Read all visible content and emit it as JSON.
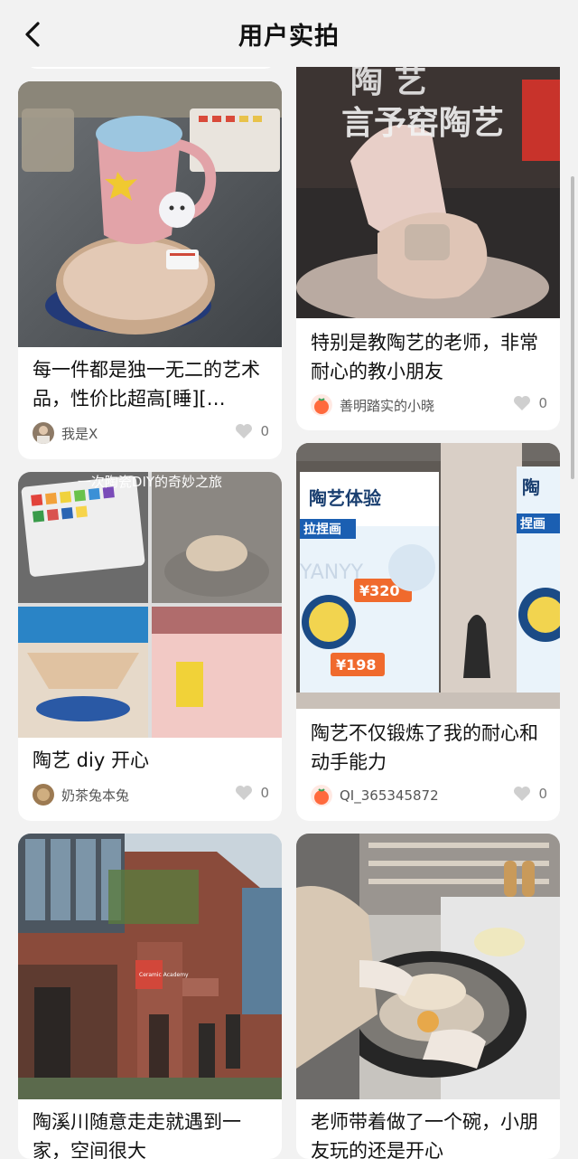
{
  "header": {
    "title": "用户实拍"
  },
  "cards": [
    {
      "caption": "每一件都是独一无二的艺术品，性价比超高[睡][…",
      "author": "我是X",
      "likes": "0"
    },
    {
      "overlay": "言予窑陶艺",
      "caption": "特别是教陶艺的老师，非常耐心的教小朋友",
      "author": "善明踏实的小晓",
      "likes": "0"
    },
    {
      "overlay": "一次陶瓷DIY的奇妙之旅",
      "caption": "陶艺 diy 开心",
      "author": "奶茶兔本兔",
      "likes": "0"
    },
    {
      "poster_title": "陶艺体验",
      "poster_side": "陶",
      "poster_tag": "拉捏画",
      "poster_tag2": "捏画",
      "poster_watermark": "YANYY",
      "poster_price_old": "¥320",
      "poster_price_new": "¥198",
      "caption": "陶艺不仅锻炼了我的耐心和动手能力",
      "author": "QI_365345872",
      "likes": "0"
    },
    {
      "sign": "Ceramic Academy",
      "caption": "陶溪川随意走走就遇到一家，空间很大",
      "author": "",
      "likes": ""
    },
    {
      "caption": "老师带着做了一个碗，小朋友玩的还是开心",
      "author": "",
      "likes": ""
    }
  ],
  "colors": {
    "accent": "#ff6a3d",
    "heart": "#cfcfcf",
    "background": "#f2f2f2"
  }
}
